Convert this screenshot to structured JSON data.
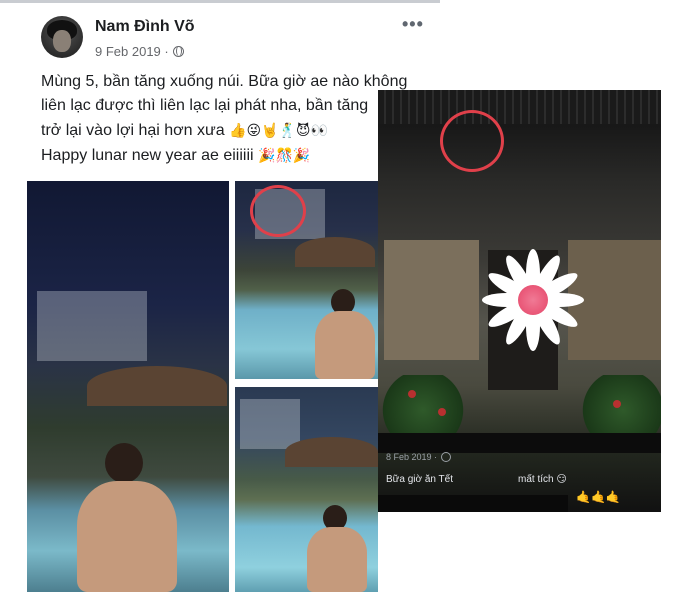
{
  "post": {
    "author": "Nam Đình Võ",
    "date": "9 Feb 2019 ·",
    "more_label": "•••",
    "lines": [
      "Mùng 5, bần tăng xuống núi. Bữa giờ ae nào không",
      "liên lạc được thì liên lạc lại phát nha, bần tăng",
      "trở lại vào lợi hại hơn xưa",
      "Happy lunar new year ae eiiiiii"
    ],
    "line3_emoji": "👍😜🤘🕺😈👀",
    "line4_emoji": "🎉🎊🎉"
  },
  "story": {
    "date": "8 Feb 2019 ·",
    "caption": "Bữa giờ ăn Tết",
    "caption_right": "mất tích 😏",
    "reaction": "🤙🤙🤙"
  },
  "colors": {
    "highlight_circle": "#e0404a",
    "meta_gray": "#65676b"
  }
}
